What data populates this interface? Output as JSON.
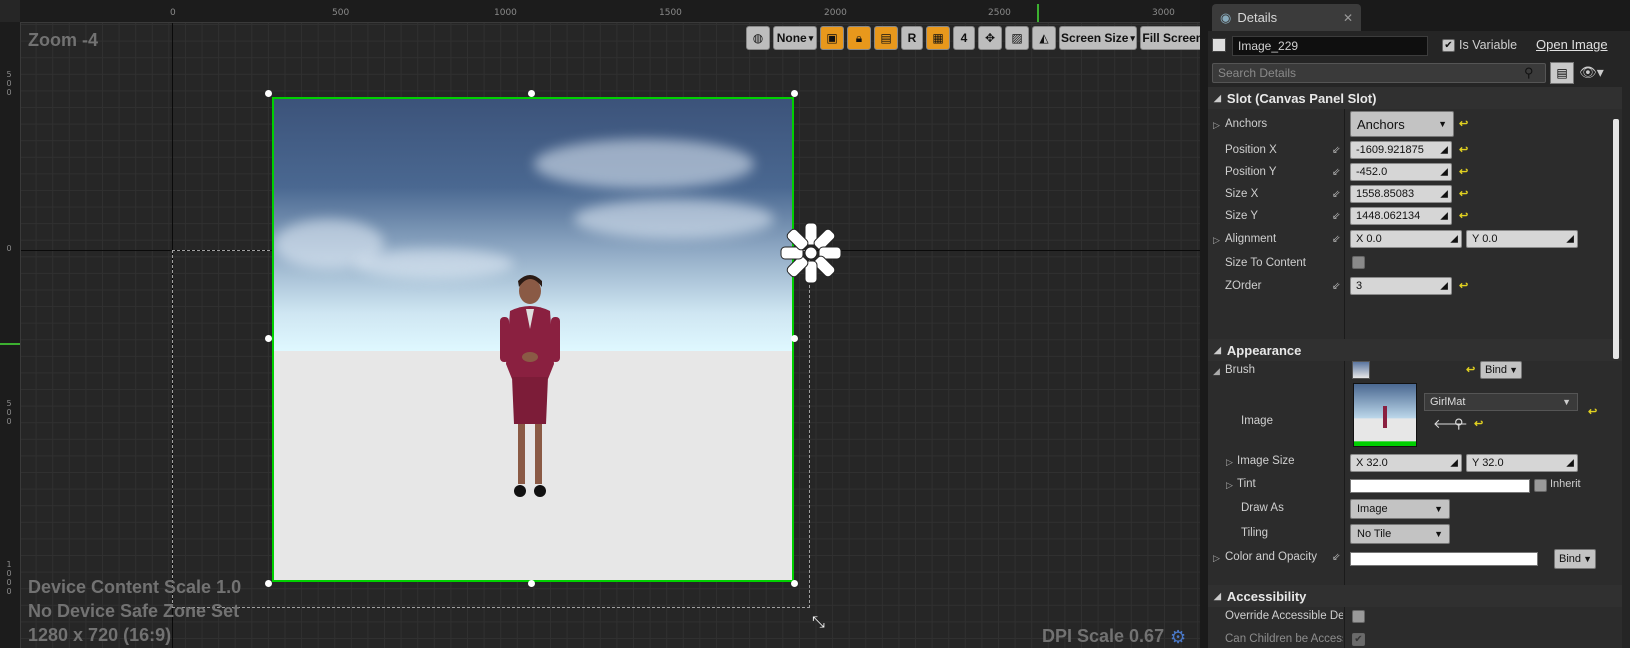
{
  "viewport": {
    "zoom_label": "Zoom -4",
    "device_content_scale": "Device Content Scale 1.0",
    "safe_zone": "No Device Safe Zone Set",
    "resolution": "1280 x 720 (16:9)",
    "dpi_scale": "DPI Scale 0.67",
    "ruler_top": [
      "0",
      "500",
      "1000",
      "1500",
      "2000",
      "2500",
      "3000"
    ],
    "ruler_left": [
      "500",
      "0",
      "500",
      "1000"
    ],
    "toolbar": {
      "locale_none": "None",
      "r_label": "R",
      "grid_snap": "4",
      "screen_size": "Screen Size",
      "fill_screen": "Fill Screen"
    }
  },
  "details": {
    "tab_title": "Details",
    "widget_name": "Image_229",
    "is_variable_label": "Is Variable",
    "is_variable_checked": true,
    "open_image": "Open Image",
    "search_placeholder": "Search Details",
    "slot_section": "Slot (Canvas Panel Slot)",
    "anchors": {
      "label": "Anchors",
      "value": "Anchors"
    },
    "position_x": {
      "label": "Position X",
      "value": "-1609.921875"
    },
    "position_y": {
      "label": "Position Y",
      "value": "-452.0"
    },
    "size_x": {
      "label": "Size X",
      "value": "1558.85083"
    },
    "size_y": {
      "label": "Size Y",
      "value": "1448.062134"
    },
    "alignment": {
      "label": "Alignment",
      "x": "X  0.0",
      "y": "Y  0.0"
    },
    "size_to_content": {
      "label": "Size To Content",
      "checked": false
    },
    "zorder": {
      "label": "ZOrder",
      "value": "3"
    },
    "appearance_section": "Appearance",
    "brush": {
      "label": "Brush",
      "bind": "Bind"
    },
    "image": {
      "label": "Image",
      "asset": "GirlMat"
    },
    "image_size": {
      "label": "Image Size",
      "x": "X  32.0",
      "y": "Y  32.0"
    },
    "tint": {
      "label": "Tint",
      "inherit": "Inherit"
    },
    "draw_as": {
      "label": "Draw As",
      "value": "Image"
    },
    "tiling": {
      "label": "Tiling",
      "value": "No Tile"
    },
    "color_opacity": {
      "label": "Color and Opacity",
      "bind": "Bind"
    },
    "accessibility_section": "Accessibility",
    "override_accessible": {
      "label": "Override Accessible Defa",
      "checked": false
    },
    "can_children": {
      "label": "Can Children be Accessib",
      "checked": true
    }
  },
  "colors": {
    "selection_green": "#00d000",
    "toolbar_orange": "#e8981c",
    "reset_yellow": "#e0d020"
  }
}
